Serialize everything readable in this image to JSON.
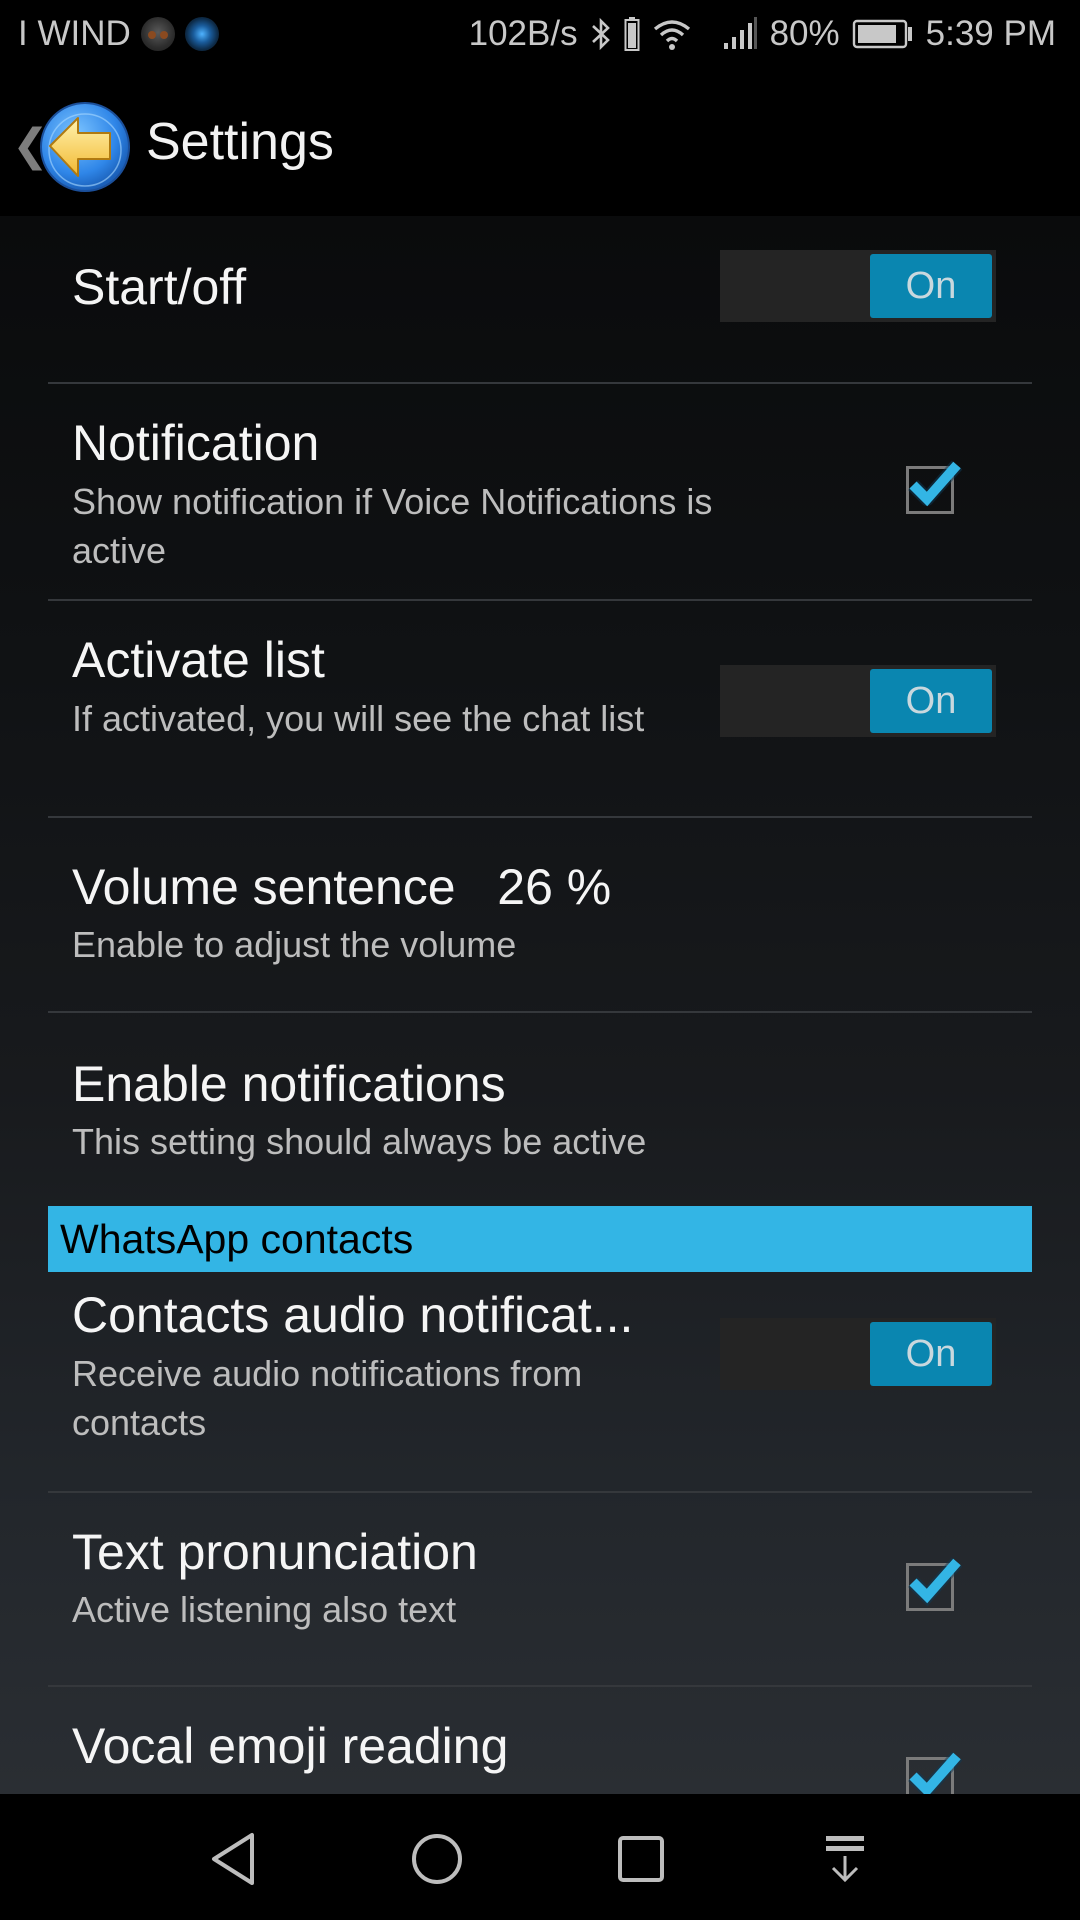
{
  "status_bar": {
    "carrier": "I WIND",
    "notification_icons": [
      "gorilla-emoji-icon",
      "voice-notifications-app-icon"
    ],
    "network_speed": "102B/s",
    "battery_percent": "80%",
    "time": "5:39 PM",
    "icons": [
      "bluetooth-icon",
      "bluetooth-battery-icon",
      "wifi-icon",
      "signal-icon",
      "battery-icon"
    ]
  },
  "action_bar": {
    "title": "Settings",
    "up_icon": "chevron-left-icon",
    "app_icon": "back-arrow-icon"
  },
  "preferences": [
    {
      "title": "Start/off",
      "summary": "",
      "widget": "switch",
      "state": "On"
    },
    {
      "title": "Notification",
      "summary": "Show notification if Voice Notifications is active",
      "widget": "checkbox",
      "checked": true
    },
    {
      "title": "Activate list",
      "summary": "If activated, you will see the chat list",
      "widget": "switch",
      "state": "On"
    },
    {
      "title": "Volume sentence   26 %",
      "summary": "Enable to adjust the volume",
      "widget": "none"
    },
    {
      "title": "Enable notifications",
      "summary": "This setting should always be active",
      "widget": "none"
    }
  ],
  "category": {
    "title": "WhatsApp contacts",
    "color": "#33b5e5"
  },
  "contacts_preferences": [
    {
      "title": "Contacts audio notificat...",
      "summary": "Receive audio notifications from contacts",
      "widget": "switch",
      "state": "On"
    },
    {
      "title": "Text pronunciation",
      "summary": "Active listening also text",
      "widget": "checkbox",
      "checked": true
    },
    {
      "title": "Vocal emoji reading",
      "summary": "",
      "widget": "checkbox",
      "checked": true
    }
  ],
  "nav_bar": {
    "buttons": [
      "back-icon",
      "home-icon",
      "recents-icon",
      "notification-pull-down-icon"
    ]
  },
  "colors": {
    "accent": "#33b5e5",
    "switch_on": "#0a86b0",
    "check": "#33b5e5"
  }
}
